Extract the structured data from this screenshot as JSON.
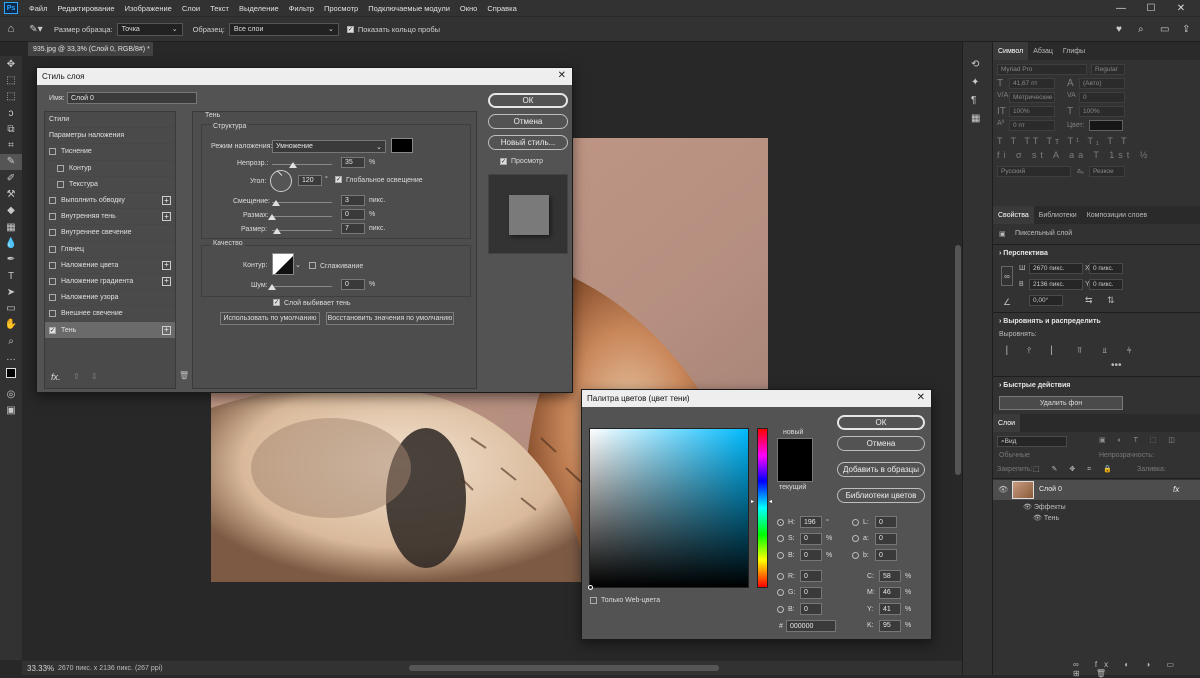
{
  "menubar": {
    "items": [
      "Файл",
      "Редактирование",
      "Изображение",
      "Слои",
      "Текст",
      "Выделение",
      "Фильтр",
      "Просмотр",
      "Подключаемые модули",
      "Окно",
      "Справка"
    ]
  },
  "options": {
    "sample_size_label": "Размер образца:",
    "sample_size_value": "Точка",
    "sample_label": "Образец:",
    "sample_value": "Все слои",
    "show_ring_label": "Показать кольцо пробы"
  },
  "document": {
    "tab_title": "935.jpg @ 33,3% (Слой 0, RGB/8#) *",
    "zoom": "33.33%",
    "info": "2670 пикс. x 2136 пикс. (267 ppi)"
  },
  "layer_style": {
    "title": "Стиль слоя",
    "name_label": "Имя:",
    "name_value": "Слой 0",
    "list_header": "Стили",
    "blend_options": "Параметры наложения",
    "items": [
      {
        "label": "Тиснение",
        "checked": false,
        "plus": false,
        "indent": 0
      },
      {
        "label": "Контур",
        "checked": false,
        "plus": false,
        "indent": 1
      },
      {
        "label": "Текстура",
        "checked": false,
        "plus": false,
        "indent": 1
      },
      {
        "label": "Выполнить обводку",
        "checked": false,
        "plus": true,
        "indent": 0
      },
      {
        "label": "Внутренняя тень",
        "checked": false,
        "plus": true,
        "indent": 0
      },
      {
        "label": "Внутреннее свечение",
        "checked": false,
        "plus": false,
        "indent": 0
      },
      {
        "label": "Глянец",
        "checked": false,
        "plus": false,
        "indent": 0
      },
      {
        "label": "Наложение цвета",
        "checked": false,
        "plus": true,
        "indent": 0
      },
      {
        "label": "Наложение градиента",
        "checked": false,
        "plus": true,
        "indent": 0
      },
      {
        "label": "Наложение узора",
        "checked": false,
        "plus": false,
        "indent": 0
      },
      {
        "label": "Внешнее свечение",
        "checked": false,
        "plus": false,
        "indent": 0
      },
      {
        "label": "Тень",
        "checked": true,
        "plus": true,
        "indent": 0
      }
    ],
    "fx_label": "fx.",
    "section_title": "Тень",
    "structure_title": "Структура",
    "blend_mode_label": "Режим наложения:",
    "blend_mode_value": "Умножение",
    "opacity_label": "Непрозр.:",
    "opacity_value": "35",
    "angle_label": "Угол:",
    "angle_value": "120",
    "global_light_label": "Глобальное освещение",
    "distance_label": "Смещение:",
    "distance_value": "3",
    "spread_label": "Размах:",
    "spread_value": "0",
    "size_label": "Размер:",
    "size_value": "7",
    "unit_px": "пикс.",
    "unit_pct": "%",
    "unit_deg": "°",
    "quality_title": "Качество",
    "contour_label": "Контур:",
    "antialias_label": "Сглаживание",
    "noise_label": "Шум:",
    "noise_value": "0",
    "knockout_label": "Слой выбивает тень",
    "make_default": "Использовать по умолчанию",
    "reset_default": "Восстановить значения по умолчанию",
    "ok": "ОК",
    "cancel": "Отмена",
    "new_style": "Новый стиль...",
    "preview_label": "Просмотр"
  },
  "color_picker": {
    "title": "Палитра цветов (цвет тени)",
    "ok": "ОК",
    "cancel": "Отмена",
    "add_swatches": "Добавить в образцы",
    "libraries": "Библиотеки цветов",
    "new_label": "новый",
    "current_label": "текущий",
    "web_only": "Только Web-цвета",
    "hsb": [
      {
        "k": "H:",
        "v": "196",
        "u": "°",
        "on": true
      },
      {
        "k": "S:",
        "v": "0",
        "u": "%",
        "on": false
      },
      {
        "k": "B:",
        "v": "0",
        "u": "%",
        "on": false
      }
    ],
    "rgb": [
      {
        "k": "R:",
        "v": "0"
      },
      {
        "k": "G:",
        "v": "0"
      },
      {
        "k": "B:",
        "v": "0"
      }
    ],
    "lab": [
      {
        "k": "L:",
        "v": "0"
      },
      {
        "k": "a:",
        "v": "0"
      },
      {
        "k": "b:",
        "v": "0"
      }
    ],
    "cmyk": [
      {
        "k": "C:",
        "v": "58",
        "u": "%"
      },
      {
        "k": "M:",
        "v": "46",
        "u": "%"
      },
      {
        "k": "Y:",
        "v": "41",
        "u": "%"
      },
      {
        "k": "K:",
        "v": "95",
        "u": "%"
      }
    ],
    "hex_label": "#",
    "hex_value": "000000",
    "colors": {
      "hue_base": "#00bbff",
      "new": "#000000",
      "current": "#000000"
    }
  },
  "right_panels": {
    "char_tabs": [
      "Символ",
      "Абзац",
      "Глифы"
    ],
    "font_family": "Myriad Pro",
    "font_style": "Regular",
    "font_size": "41,67 пт",
    "leading": "(Авто)",
    "kerning": "Метрические",
    "tracking": "0",
    "scale_v": "100%",
    "scale_h": "100%",
    "baseline": "0 пт",
    "color_label": "Цвет:",
    "language": "Русский",
    "aa": "Резкое",
    "props_tabs": [
      "Свойства",
      "Библиотеки",
      "Композиции слоев"
    ],
    "pixel_layer": "Пиксельный слой",
    "perspective_title": "Перспектива",
    "w_label": "Ш",
    "w_value": "2670 пикс.",
    "h_label": "В",
    "h_value": "2136 пикс.",
    "x_label": "X",
    "x_value": "0 пикс.",
    "y_label": "Y",
    "y_value": "0 пикс.",
    "angle": "0,00°",
    "align_title": "Выровнять и распределить",
    "align_label": "Выровнять:",
    "quick_title": "Быстрые действия",
    "remove_bg": "Удалить фон",
    "layers_tab": "Слои",
    "search_placeholder": "Вид",
    "blend_mode": "Обычные",
    "opacity_label": "Непрозрачность:",
    "lock_label": "Закрепить:",
    "fill_label": "Заливка:",
    "layer_name": "Слой 0",
    "effects_label": "Эффекты",
    "shadow_label": "Тень"
  }
}
